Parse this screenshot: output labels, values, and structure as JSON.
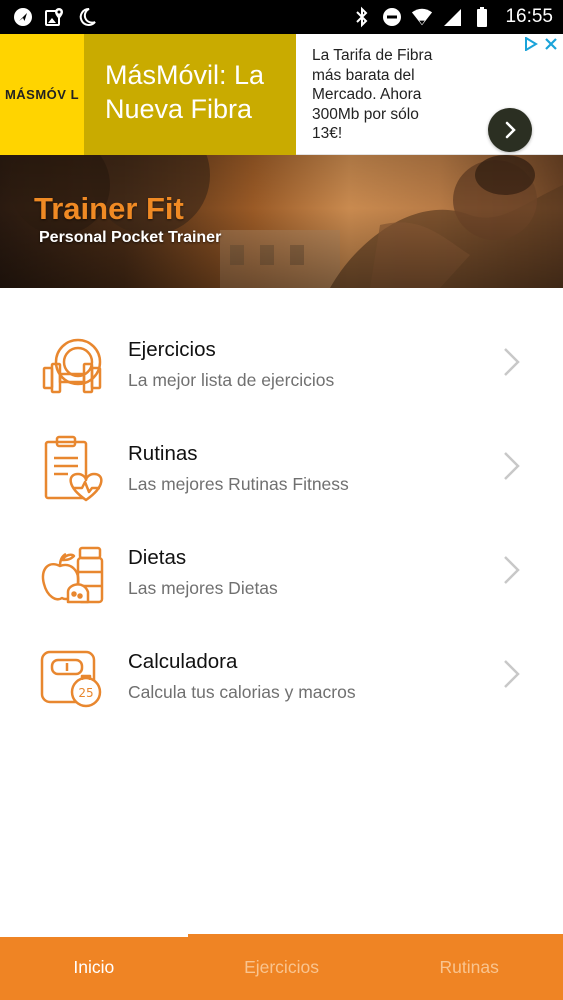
{
  "status_bar": {
    "time": "16:55",
    "icons_left": [
      "navigation-icon",
      "gallery-location-icon",
      "do-not-disturb-moon-icon"
    ],
    "icons_right": [
      "bluetooth-icon",
      "minus-circle-icon",
      "wifi-icon",
      "signal-icon",
      "battery-icon"
    ]
  },
  "ad": {
    "logo_text": "MÁSMÓV L",
    "headline": [
      "MásMóvil: La",
      "Nueva Fibra"
    ],
    "copy": [
      "La Tarifa de Fibra",
      "más barata del",
      "Mercado. Ahora",
      "300Mb por sólo",
      "13€!"
    ],
    "colors": {
      "logo_bg": "#ffd400",
      "headline_bg": "#c9ab00",
      "choices": "#1aa3d9"
    }
  },
  "hero": {
    "title": "Trainer Fit",
    "subtitle": "Personal Pocket Trainer"
  },
  "menu": [
    {
      "title": "Ejercicios",
      "subtitle": "La mejor lista de ejercicios",
      "icon": "dumbbell-icon"
    },
    {
      "title": "Rutinas",
      "subtitle": "Las mejores Rutinas Fitness",
      "icon": "clipboard-heart-icon"
    },
    {
      "title": "Dietas",
      "subtitle": "Las mejores Dietas",
      "icon": "food-supplements-icon"
    },
    {
      "title": "Calculadora",
      "subtitle": "Calcula tus calorias y macros",
      "icon": "scale-icon"
    }
  ],
  "bottom_nav": {
    "tabs": [
      "Inicio",
      "Ejercicios",
      "Rutinas"
    ],
    "active": "Inicio"
  },
  "colors": {
    "accent": "#ef8424",
    "icon_stroke": "#e8872f",
    "chevron": "#c8c8c8"
  }
}
